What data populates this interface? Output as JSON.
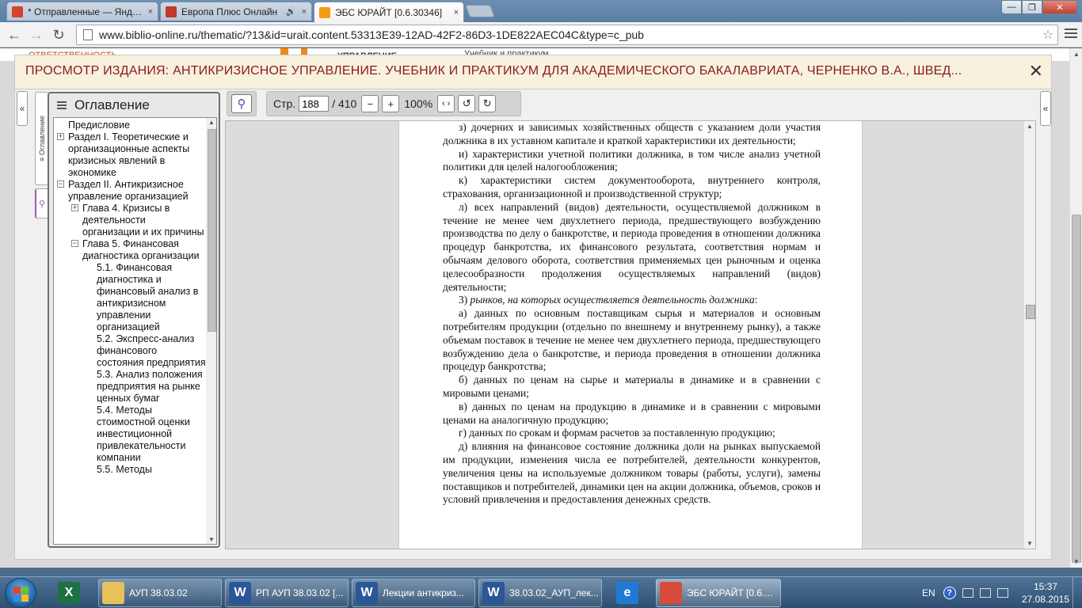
{
  "browser": {
    "tabs": [
      {
        "title": "* Отправленные — Яндекс",
        "fav_color": "#d9412d",
        "active": false,
        "audio": false
      },
      {
        "title": "Европа Плюс Онлайн",
        "fav_color": "#c0392b",
        "active": false,
        "audio": true
      },
      {
        "title": "ЭБС ЮРАЙТ [0.6.30346]",
        "fav_color": "#f39c12",
        "active": true,
        "audio": false
      }
    ],
    "close_glyph": "×",
    "audio_glyph": "🔊",
    "window": {
      "minimize": "—",
      "maximize": "❐",
      "close": "✕"
    },
    "nav": {
      "back": "←",
      "forward": "→",
      "reload": "↻"
    },
    "url": "www.biblio-online.ru/thematic/?13&id=urait.content.53313E39-12AD-42F2-86D3-1DE822AEC04C&type=c_pub",
    "star": "☆"
  },
  "background_page": {
    "left_text": "ответственность",
    "middle_text": "управление",
    "right_text": "Учебник и практикум"
  },
  "modal": {
    "title": "ПРОСМОТР ИЗДАНИЯ: АНТИКРИЗИСНОЕ УПРАВЛЕНИЕ. УЧЕБНИК И ПРАКТИКУМ ДЛЯ АКАДЕМИЧЕСКОГО БАКАЛАВРИАТА, ЧЕРНЕНКО В.А., ШВЕД...",
    "close": "✕",
    "collapse_left": "«",
    "collapse_right": "«"
  },
  "sidetabs": {
    "toc_label": "≡ Оглавление",
    "search_glyph": "⚲"
  },
  "toc": {
    "title": "Оглавление",
    "items": [
      {
        "text": "Предисловие",
        "level": 0,
        "toggle": ""
      },
      {
        "text": "Раздел I. Теоретические и организационные аспекты кризисных явлений в экономике",
        "level": 0,
        "toggle": "+"
      },
      {
        "text": "Раздел II. Антикризисное управление организацией",
        "level": 0,
        "toggle": "−"
      },
      {
        "text": "Глава 4. Кризисы в деятельности организации и их причины",
        "level": 1,
        "toggle": "+"
      },
      {
        "text": "Глава 5. Финансовая диагностика организации",
        "level": 1,
        "toggle": "−"
      },
      {
        "text": "5.1. Финансовая диагностика и финансовый анализ в антикризисном управлении организацией",
        "level": 2,
        "toggle": ""
      },
      {
        "text": "5.2. Экспресс-анализ финансового состояния предприятия",
        "level": 2,
        "toggle": ""
      },
      {
        "text": "5.3. Анализ положения предприятия на рынке ценных бумаг",
        "level": 2,
        "toggle": ""
      },
      {
        "text": "5.4. Методы стоимостной оценки инвестиционной привлекательности компании",
        "level": 2,
        "toggle": ""
      },
      {
        "text": "5.5. Методы",
        "level": 2,
        "toggle": ""
      }
    ]
  },
  "viewer": {
    "search_icon": "⚲",
    "page_label": "Стр.",
    "page_value": "188",
    "page_total": "/ 410",
    "zoom_out": "−",
    "zoom_in": "+",
    "zoom": "100%",
    "fit_width": "‹ ›",
    "rotate_left": "↺",
    "rotate_right": "↻"
  },
  "document": {
    "paragraphs": [
      {
        "indent": true,
        "text": "з) дочерних и зависимых хозяйственных обществ с указанием доли участия должника в их уставном капитале и краткой характеристики их деятельности;"
      },
      {
        "indent": true,
        "text": "и) характеристики учетной политики должника, в том числе анализ учетной политики для целей налогообложения;"
      },
      {
        "indent": true,
        "text": "к) характеристики систем документооборота, внутреннего контроля, страхования, организационной и производственной структур;"
      },
      {
        "indent": true,
        "text": "л) всех направлений (видов) деятельности, осуществляемой должником в течение не менее чем двухлетнего периода, предшествующего возбуждению производства по делу о банкротстве, и периода проведения в отношении должника процедур банкротства, их финансового результата, соответствия нормам и обычаям делового оборота, соответствия применяемых цен рыночным и оценка целесообразности продолжения осуществляемых направлений (видов) деятельности;"
      },
      {
        "indent": true,
        "text": "3) ",
        "italic": "рынков, на которых осуществляется деятельность должника",
        "tail": ":"
      },
      {
        "indent": true,
        "text": "а) данных по основным поставщикам сырья и материалов и основным потребителям продукции (отдельно по внешнему и внутреннему рынку), а также объемам поставок в течение не менее чем двухлетнего периода, предшествующего возбуждению дела о банкротстве, и периода проведения в отношении должника процедур банкротства;"
      },
      {
        "indent": true,
        "text": "б) данных по ценам на сырье и материалы в динамике и в сравнении с мировыми ценами;"
      },
      {
        "indent": true,
        "text": "в) данных по ценам на продукцию в динамике и в сравнении с мировыми ценами на аналогичную продукцию;"
      },
      {
        "indent": true,
        "text": "г) данных по срокам и формам расчетов за поставленную продукцию;"
      },
      {
        "indent": true,
        "text": "д) влияния на финансовое состояние должника доли на рынках выпускаемой им продукции, изменения числа ее потребителей, деятельности конкурентов, увеличения цены на используемые должником товары (работы, услуги), замены поставщиков и потребителей, динамики цен на акции должника, объемов, сроков и условий привлечения и предоставления денежных средств."
      }
    ]
  },
  "taskbar": {
    "items": [
      {
        "label": "",
        "icon_text": "X",
        "icon_color": "#1e7145",
        "pinned": true
      },
      {
        "label": "АУП 38.03.02",
        "icon_text": "",
        "icon_color": "#e8c15a",
        "pinned": false
      },
      {
        "label": "РП АУП 38.03.02 [...",
        "icon_text": "W",
        "icon_color": "#2b5797",
        "pinned": false
      },
      {
        "label": "Лекции антикриз...",
        "icon_text": "W",
        "icon_color": "#2b5797",
        "pinned": false
      },
      {
        "label": "38.03.02_АУП_лек...",
        "icon_text": "W",
        "icon_color": "#2b5797",
        "pinned": false
      },
      {
        "label": "",
        "icon_text": "e",
        "icon_color": "#1f7ad6",
        "pinned": true
      },
      {
        "label": "ЭБС ЮРАЙТ [0.6....",
        "icon_text": "",
        "icon_color": "#d64b3b",
        "pinned": false
      }
    ],
    "lang": "EN",
    "help": "?",
    "time": "15:37",
    "date": "27.08.2015"
  }
}
